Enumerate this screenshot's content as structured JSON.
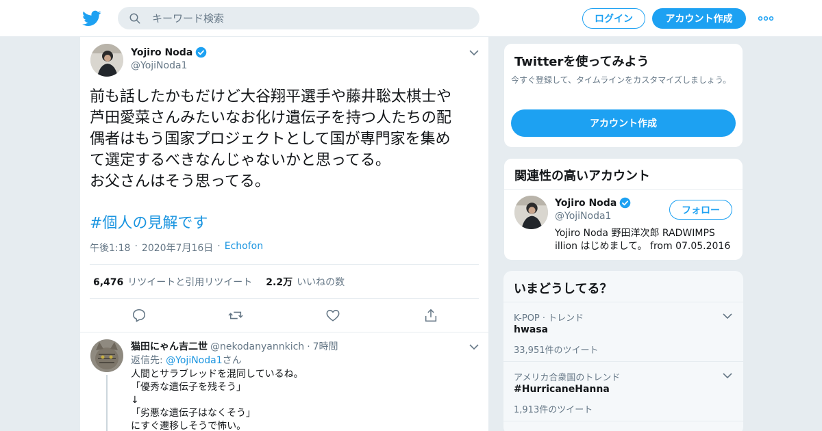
{
  "header": {
    "search_placeholder": "キーワード検索",
    "login_label": "ログイン",
    "signup_label": "アカウント作成"
  },
  "tweet": {
    "author_name": "Yojiro Noda",
    "author_handle": "@YojiNoda1",
    "text": "前も話したかもだけど大谷翔平選手や藤井聡太棋士や\n芦田愛菜さんみたいなお化け遺伝子を持つ人たちの配\n偶者はもう国家プロジェクトとして国が専門家を集め\nて選定するべきなんじゃないかと思ってる。\nお父さんはそう思ってる。",
    "hashtag": "#個人の見解です",
    "time": "午後1:18",
    "date": "2020年7月16日",
    "source": "Echofon",
    "retweets": "6,476",
    "retweets_label": "リツイートと引用リツイート",
    "likes": "2.2万",
    "likes_label": "いいねの数"
  },
  "reply": {
    "name": "猫田にゃん吉二世",
    "handle": "@nekodanyannkich",
    "time": "7時間",
    "reply_to_prefix": "返信先: ",
    "reply_to_handle": "@YojiNoda1",
    "reply_to_suffix": "さん",
    "text": "人間とサラブレッドを混同しているね。\n「優秀な遺伝子を残そう」\n↓\n「劣悪な遺伝子はなくそう」\nにすぐ遷移しそうで怖い。"
  },
  "signup_card": {
    "title": "Twitterを使ってみよう",
    "desc": "今すぐ登録して、タイムラインをカスタマイズしましょう。",
    "button": "アカウント作成"
  },
  "related": {
    "title": "関連性の高いアカウント",
    "name": "Yojiro Noda",
    "handle": "@YojiNoda1",
    "follow": "フォロー",
    "bio": "Yojiro Noda 野田洋次郎 RADWIMPS illion はじめまして。 from 07.05.2016"
  },
  "trends": {
    "title": "いまどうしてる？",
    "items": [
      {
        "context": "K-POP · トレンド",
        "name": "hwasa",
        "count": "33,951件のツイート"
      },
      {
        "context": "アメリカ合衆国のトレンド",
        "name": "#HurricaneHanna",
        "count": "1,913件のツイート"
      }
    ]
  },
  "colors": {
    "accent": "#1da1f2",
    "link": "#1b95e0",
    "text": "#14171a",
    "secondary": "#657786",
    "background": "#e6ecf0"
  }
}
